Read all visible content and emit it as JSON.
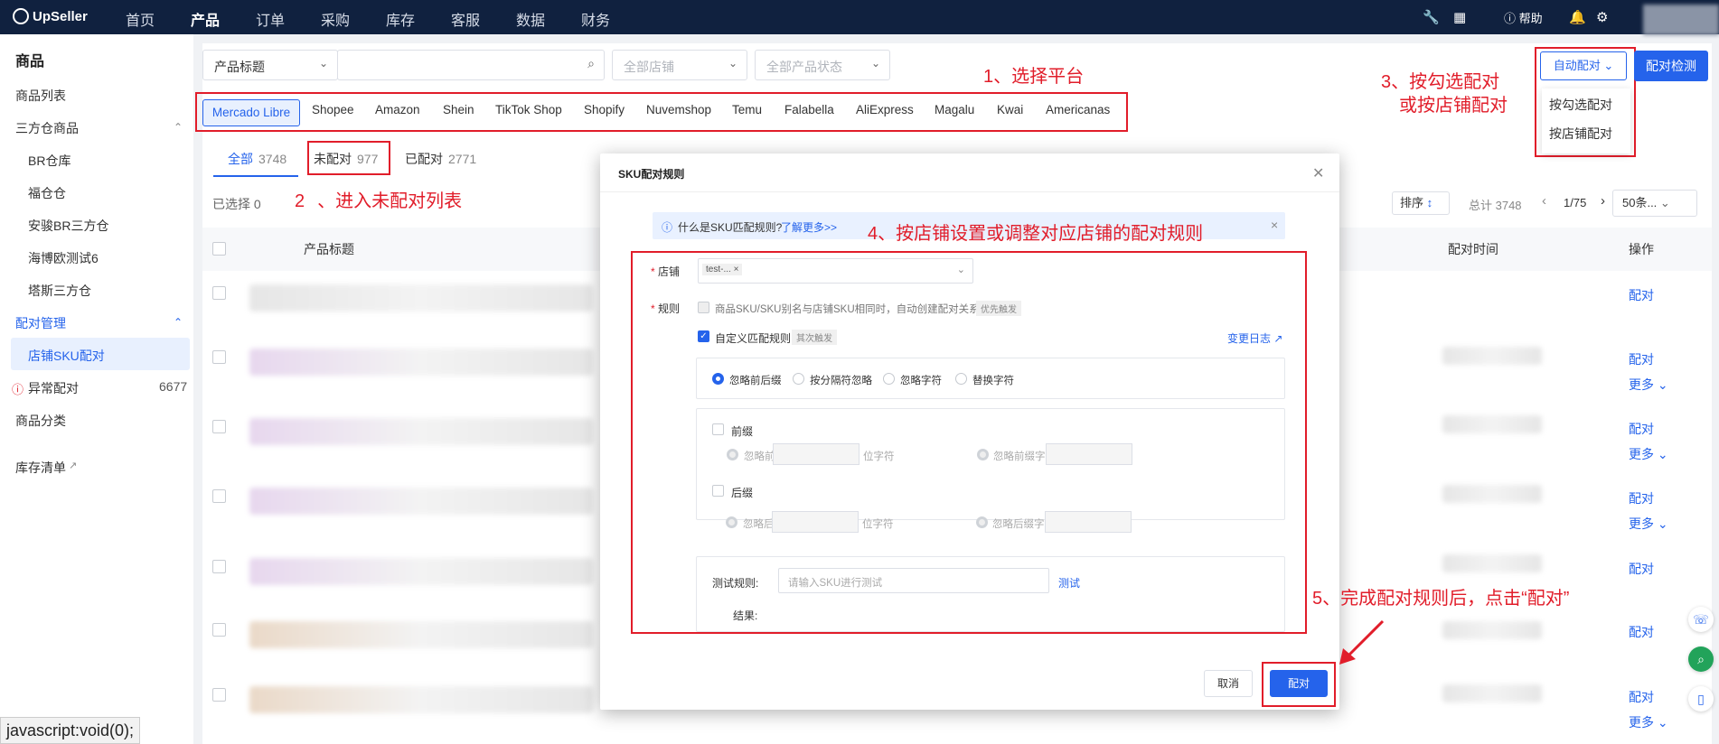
{
  "topbar": {
    "logo": "UpSeller",
    "nav": [
      "首页",
      "产品",
      "订单",
      "采购",
      "库存",
      "客服",
      "数据",
      "财务"
    ],
    "help": "帮助"
  },
  "sidebar": {
    "title": "商品",
    "items": [
      "商品列表",
      "三方仓商品",
      "BR仓库",
      "福仓仓",
      "安骏BR三方仓",
      "海博欧测试6",
      "塔斯三方仓",
      "配对管理",
      "店铺SKU配对",
      "异常配对",
      "商品分类",
      "库存清单"
    ],
    "anomaly_count": "6677"
  },
  "filters": {
    "field_select": "产品标题",
    "store_select": "全部店铺",
    "status_select": "全部产品状态"
  },
  "platforms": [
    "Mercado Libre",
    "Shopee",
    "Amazon",
    "Shein",
    "TikTok Shop",
    "Shopify",
    "Nuvemshop",
    "Temu",
    "Falabella",
    "AliExpress",
    "Magalu",
    "Kwai",
    "Americanas"
  ],
  "tabs": [
    {
      "label": "全部",
      "count": "3748"
    },
    {
      "label": "未配对",
      "count": "977"
    },
    {
      "label": "已配对",
      "count": "2771"
    }
  ],
  "toolbar": {
    "selected": "已选择 0",
    "sort": "排序",
    "total": "总计 3748",
    "page": "1/75",
    "page_size": "50条..."
  },
  "table": {
    "col_title": "产品标题",
    "col_time": "配对时间",
    "col_action": "操作",
    "action_pair": "配对",
    "action_more": "更多"
  },
  "top_right": {
    "auto_pair": "自动配对",
    "pair_check": "配对检测",
    "dropdown": [
      "按勾选配对",
      "按店铺配对"
    ]
  },
  "annotations": {
    "a1": "1、选择平台",
    "a2_num": "2",
    "a2": "、进入未配对列表",
    "a3_l1": "3、按勾选配对",
    "a3_l2": "或按店铺配对",
    "a4": "4、按店铺设置或调整对应店铺的配对规则",
    "a5": "5、完成配对规则后，点击“配对”"
  },
  "modal": {
    "title": "SKU配对规则",
    "info": "什么是SKU匹配规则?",
    "learn_more": "了解更多>>",
    "store_label": "店铺",
    "store_tag": "test-...",
    "rule_label": "规则",
    "rule_text": "商品SKU/SKU别名与店铺SKU相同时，自动创建配对关系",
    "rule_badge": "优先触发",
    "custom_rule": "自定义匹配规则",
    "custom_badge": "其次触发",
    "change_log": "变更日志",
    "options": [
      "忽略前后缀",
      "按分隔符忽略",
      "忽略字符",
      "替换字符"
    ],
    "prefix": "前缀",
    "suffix": "后缀",
    "ignore_prefix": "忽略前",
    "ignore_suffix": "忽略后",
    "unit": "位字符",
    "ignore_prefix_chars": "忽略前缀字符",
    "ignore_suffix_chars": "忽略后缀字符",
    "test_label": "测试规则:",
    "test_placeholder": "请输入SKU进行测试",
    "test_btn": "测试",
    "result_label": "结果:",
    "cancel": "取消",
    "confirm": "配对"
  },
  "status_bar": "javascript:void(0);"
}
